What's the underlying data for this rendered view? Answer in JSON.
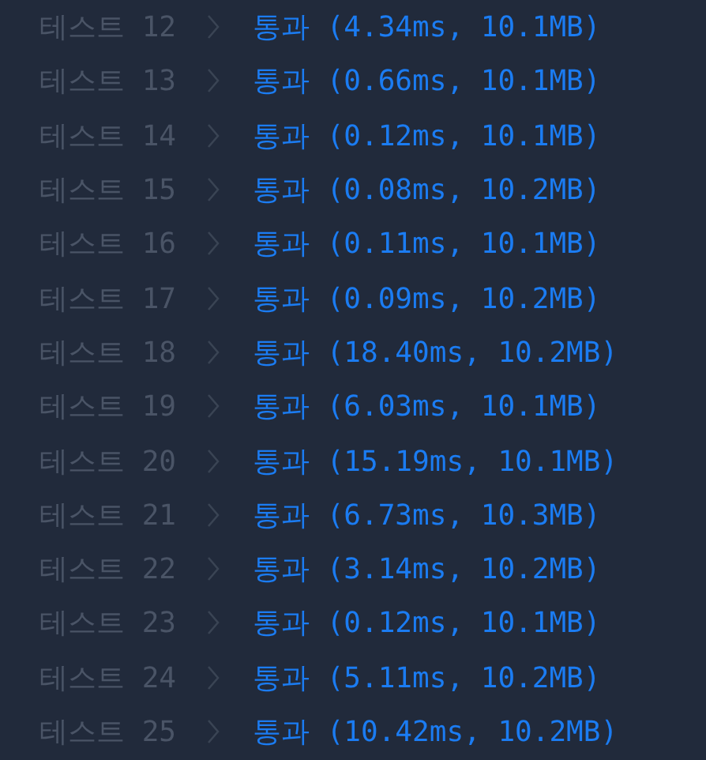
{
  "rows": [
    {
      "label": "테스트 12",
      "result": "통과 (4.34ms, 10.1MB)"
    },
    {
      "label": "테스트 13",
      "result": "통과 (0.66ms, 10.1MB)"
    },
    {
      "label": "테스트 14",
      "result": "통과 (0.12ms, 10.1MB)"
    },
    {
      "label": "테스트 15",
      "result": "통과 (0.08ms, 10.2MB)"
    },
    {
      "label": "테스트 16",
      "result": "통과 (0.11ms, 10.1MB)"
    },
    {
      "label": "테스트 17",
      "result": "통과 (0.09ms, 10.2MB)"
    },
    {
      "label": "테스트 18",
      "result": "통과 (18.40ms, 10.2MB)"
    },
    {
      "label": "테스트 19",
      "result": "통과 (6.03ms, 10.1MB)"
    },
    {
      "label": "테스트 20",
      "result": "통과 (15.19ms, 10.1MB)"
    },
    {
      "label": "테스트 21",
      "result": "통과 (6.73ms, 10.3MB)"
    },
    {
      "label": "테스트 22",
      "result": "통과 (3.14ms, 10.2MB)"
    },
    {
      "label": "테스트 23",
      "result": "통과 (0.12ms, 10.1MB)"
    },
    {
      "label": "테스트 24",
      "result": "통과 (5.11ms, 10.2MB)"
    },
    {
      "label": "테스트 25",
      "result": "통과 (10.42ms, 10.2MB)"
    }
  ]
}
